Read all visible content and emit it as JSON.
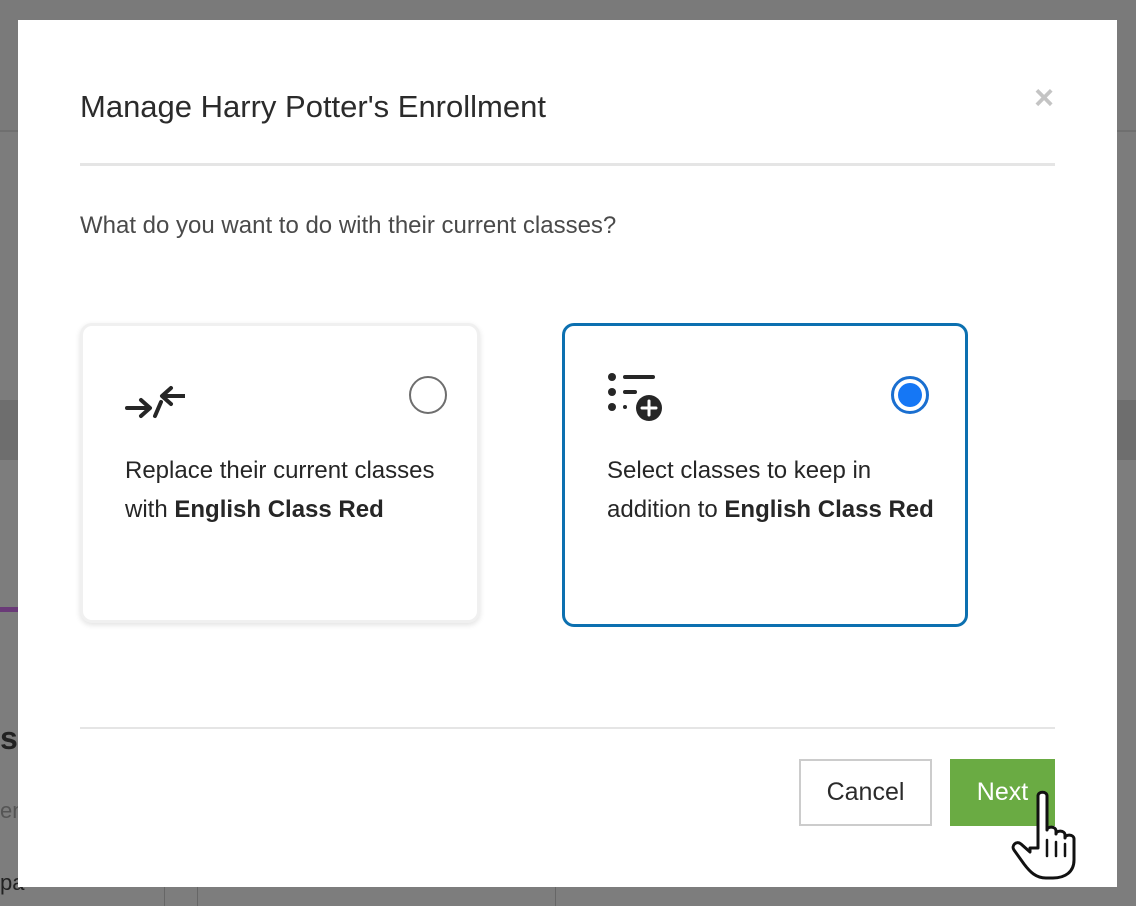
{
  "modal": {
    "title": "Manage Harry Potter's Enrollment",
    "close_glyph": "×",
    "question": "What do you want to do with their current classes?",
    "options": [
      {
        "icon": "arrows-merge-icon",
        "text_prefix": "Replace their current classes with ",
        "class_name": "English Class Red",
        "selected": false
      },
      {
        "icon": "list-add-icon",
        "text_prefix": "Select classes to keep in addition to ",
        "class_name": "English Class Red",
        "selected": true
      }
    ],
    "cancel_label": "Cancel",
    "next_label": "Next"
  },
  "background": {
    "fragment_heading": "s",
    "fragment_sub": "en",
    "fragment_body": "pa"
  },
  "colors": {
    "next_button": "#6aab43",
    "selected_border": "#0c70b0",
    "radio_selected": "#1577f5",
    "overlay": "#7a7a7a"
  }
}
